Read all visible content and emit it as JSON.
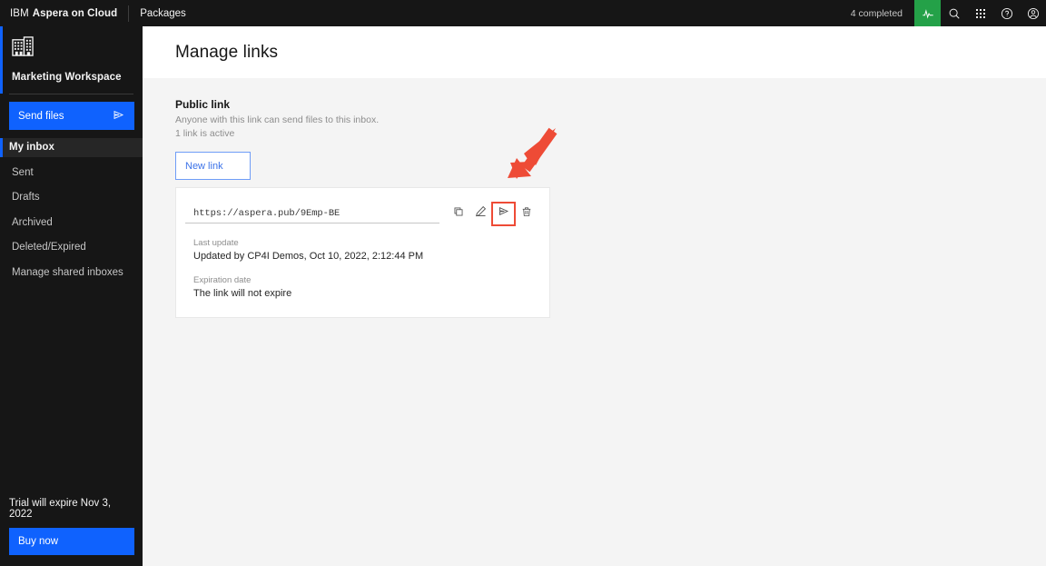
{
  "topbar": {
    "brand_ibm": "IBM",
    "brand_product": "Aspera on Cloud",
    "nav_packages": "Packages",
    "completed_text": "4 completed",
    "icons": {
      "activity": "activity-icon",
      "search": "search-icon",
      "app_switcher": "app-switcher-icon",
      "help": "help-icon",
      "account": "account-icon"
    }
  },
  "sidebar": {
    "workspace_icon": "office-building-icon",
    "workspace_name": "Marketing Workspace",
    "send_files_label": "Send files",
    "send_files_icon": "send-icon",
    "nav_items": [
      {
        "label": "My inbox",
        "active": true
      },
      {
        "label": "Sent",
        "active": false
      },
      {
        "label": "Drafts",
        "active": false
      },
      {
        "label": "Archived",
        "active": false
      },
      {
        "label": "Deleted/Expired",
        "active": false
      },
      {
        "label": "Manage shared inboxes",
        "active": false
      }
    ],
    "trial_text": "Trial will expire Nov 3, 2022",
    "buy_now_label": "Buy now"
  },
  "main": {
    "page_title": "Manage links",
    "section": {
      "title": "Public link",
      "description": "Anyone with this link can send files to this inbox.",
      "count": "1 link is active"
    },
    "new_link_label": "New link",
    "link_card": {
      "url": "https://aspera.pub/9Emp-BE",
      "actions": [
        {
          "name": "copy-icon",
          "highlighted": false
        },
        {
          "name": "edit-icon",
          "highlighted": false
        },
        {
          "name": "send-icon",
          "highlighted": true
        },
        {
          "name": "delete-icon",
          "highlighted": false
        }
      ],
      "last_update_label": "Last update",
      "last_update_value": "Updated by CP4I Demos, Oct 10, 2022, 2:12:44 PM",
      "expiration_label": "Expiration date",
      "expiration_value": "The link will not expire"
    }
  },
  "colors": {
    "header_bg": "#161616",
    "accent_blue": "#0f62fe",
    "activity_green": "#24a148",
    "content_bg": "#f4f4f4",
    "annotation_red": "#ee4b36"
  }
}
